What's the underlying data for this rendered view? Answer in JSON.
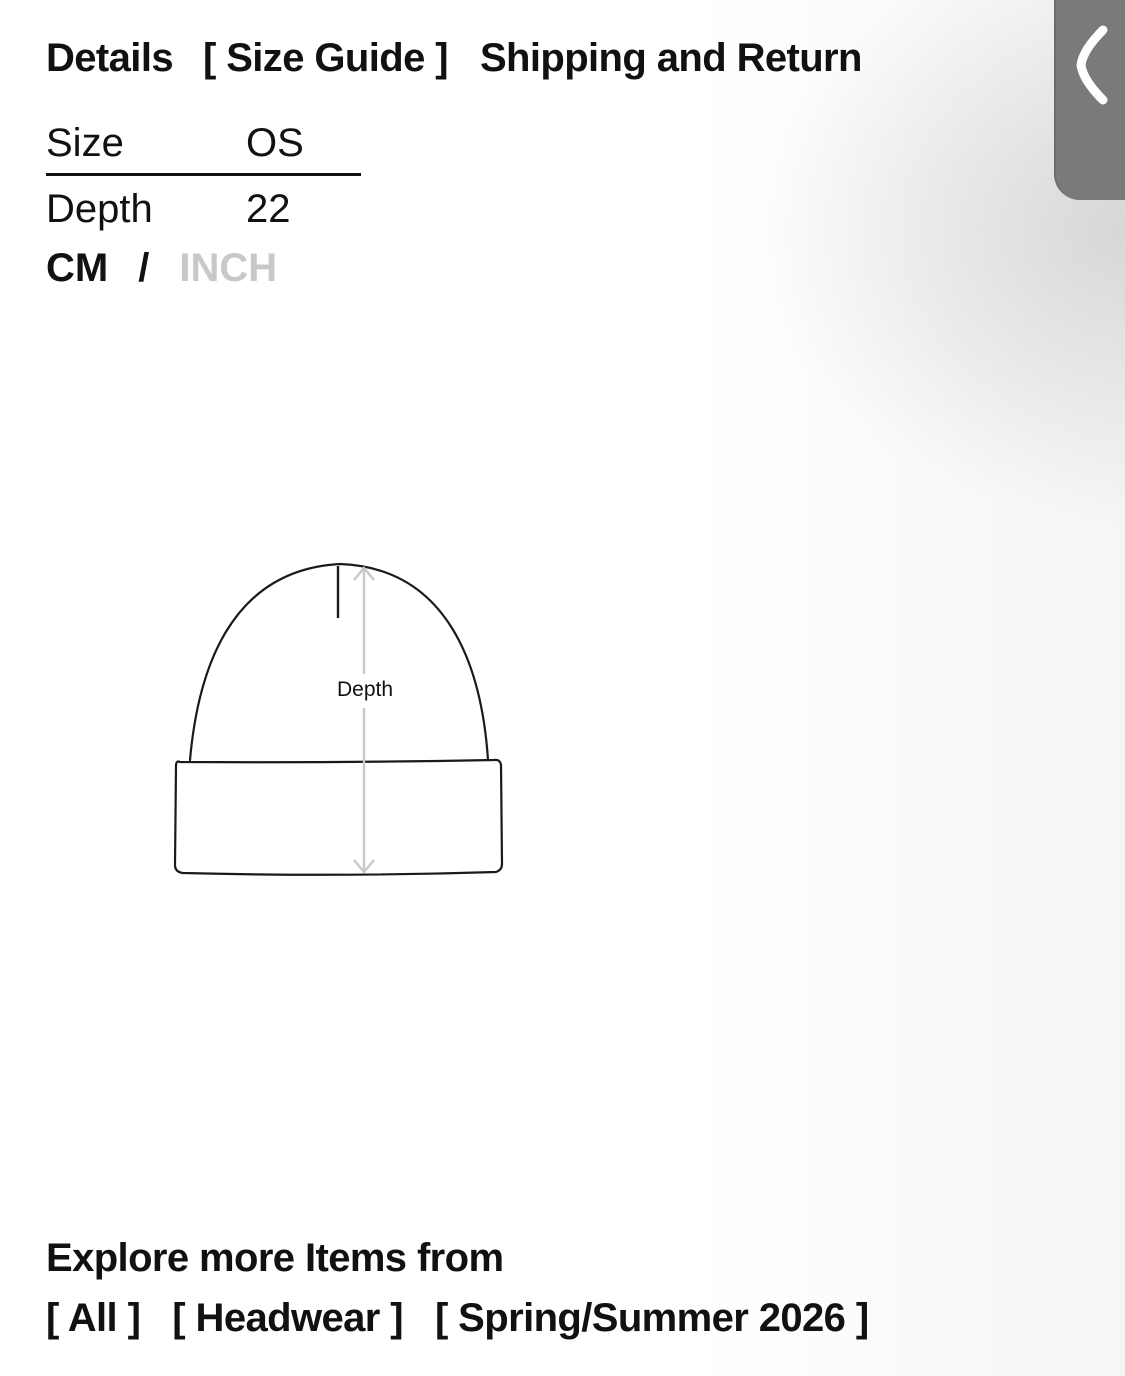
{
  "tabs": {
    "details": "Details",
    "size_guide": "[ Size Guide ]",
    "shipping": "Shipping and Return",
    "active": "size_guide"
  },
  "size_table": {
    "header": {
      "label": "Size",
      "value": "OS"
    },
    "rows": [
      {
        "label": "Depth",
        "value": "22"
      }
    ]
  },
  "units": {
    "cm": "CM",
    "separator": "/",
    "inch": "INCH",
    "selected": "cm"
  },
  "diagram": {
    "measure_label": "Depth",
    "icon": "beanie-outline-icon"
  },
  "explore": {
    "title": "Explore more Items from",
    "links": [
      "[ All ]",
      "[ Headwear ]",
      "[ Spring/Summer 2026 ]"
    ]
  },
  "side_tab": {
    "icon": "chevron-left-icon"
  },
  "colors": {
    "text": "#111111",
    "inactive": "#c8c8c8",
    "side_tab": "#7a7a7a",
    "measure_line": "#c8c8c8"
  }
}
